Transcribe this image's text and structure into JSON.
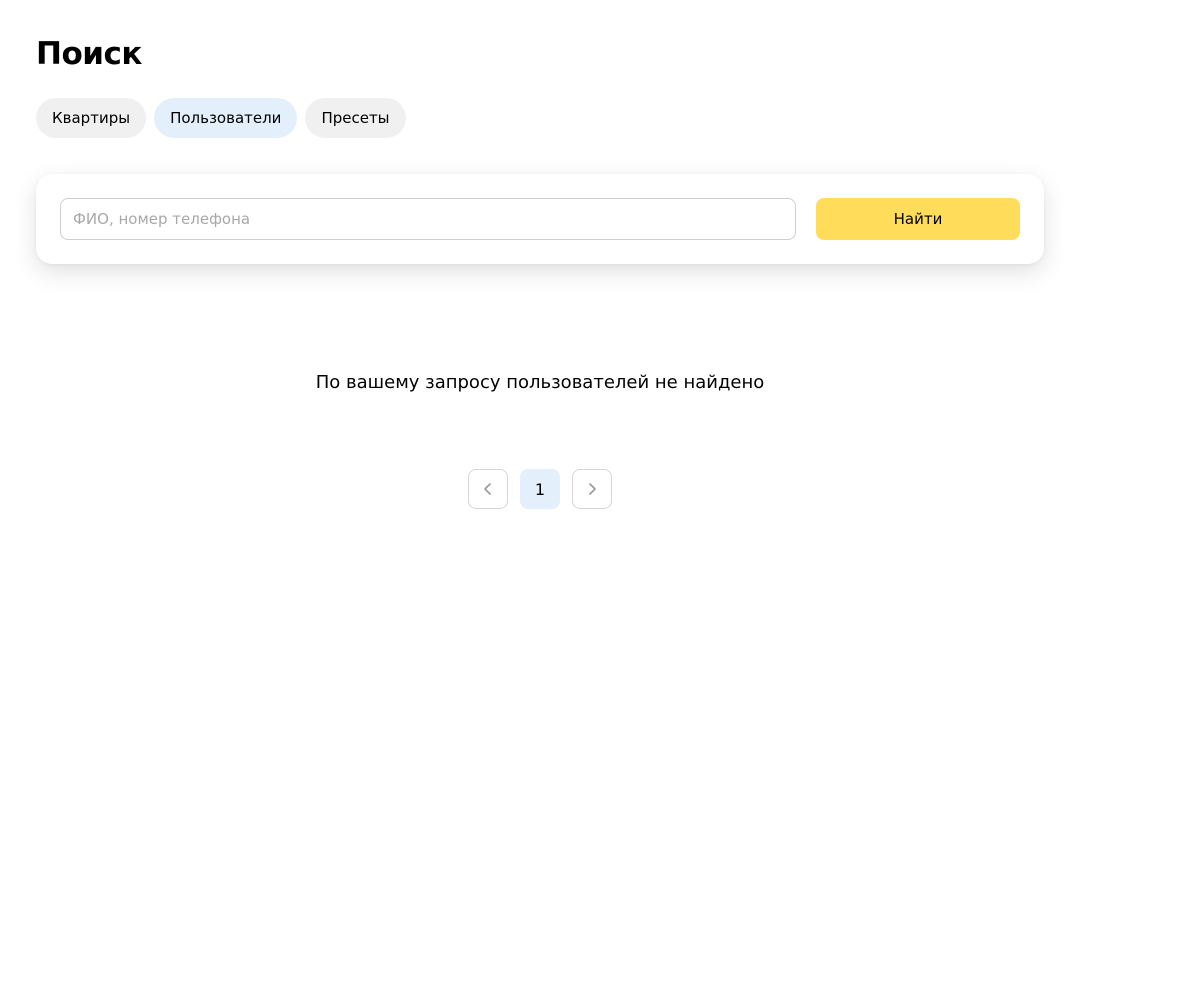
{
  "page": {
    "title": "Поиск"
  },
  "tabs": [
    {
      "label": "Квартиры",
      "active": false
    },
    {
      "label": "Пользователи",
      "active": true
    },
    {
      "label": "Пресеты",
      "active": false
    }
  ],
  "search": {
    "placeholder": "ФИО, номер телефона",
    "value": "",
    "button_label": "Найти"
  },
  "results": {
    "empty_message": "По вашему запросу пользователей не найдено"
  },
  "pagination": {
    "prev_icon": "chevron-left-icon",
    "next_icon": "chevron-right-icon",
    "pages": [
      "1"
    ],
    "current_page": "1"
  },
  "colors": {
    "accent_button": "#ffdd5a",
    "active_tab": "#e4effc",
    "inactive_tab": "#f0f0f0",
    "current_page": "#e4effc"
  }
}
